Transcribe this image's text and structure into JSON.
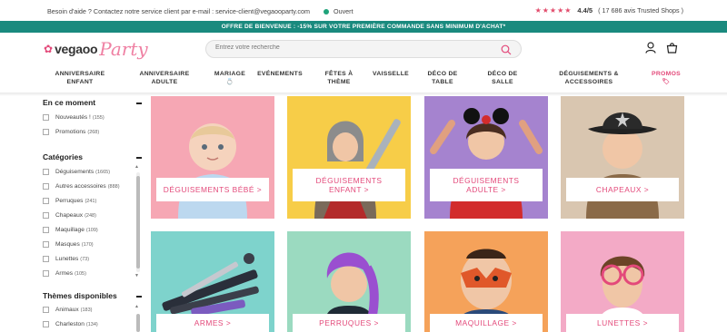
{
  "topbar": {
    "help_text": "Besoin d'aide ? Contactez notre service client par e-mail : service-client@vegaooparty.com",
    "status": "Ouvert",
    "stars": "★★★★★",
    "rating": "4.4/5",
    "reviews": "( 17 686 avis Trusted Shops )"
  },
  "promo_banner": "OFFRE DE BIENVENUE : -15% SUR VOTRE PREMIÈRE COMMANDE SANS MINIMUM D'ACHAT*",
  "logo": {
    "mark": "✿",
    "vega": "vegaoo",
    "party": "Party"
  },
  "search": {
    "placeholder": "Entrez votre recherche"
  },
  "nav": [
    {
      "line1": "Anniversaire",
      "line2": "Enfant"
    },
    {
      "line1": "Anniversaire",
      "line2": "Adulte"
    },
    {
      "line1": "Mariage",
      "line2": "💍"
    },
    {
      "line1": "Evénements",
      "line2": ""
    },
    {
      "line1": "Fêtes à",
      "line2": "Thème"
    },
    {
      "line1": "Vaisselle",
      "line2": ""
    },
    {
      "line1": "Déco de",
      "line2": "Table"
    },
    {
      "line1": "Déco de",
      "line2": "Salle"
    },
    {
      "line1": "Déguisements &",
      "line2": "Accessoires"
    },
    {
      "line1": "Promos",
      "line2": "🏷"
    }
  ],
  "sidebar": {
    "sections": [
      {
        "title": "En ce moment",
        "items": [
          {
            "label": "Nouveautés !",
            "count": "(155)"
          },
          {
            "label": "Promotions",
            "count": "(268)"
          }
        ]
      },
      {
        "title": "Catégories",
        "items": [
          {
            "label": "Déguisements",
            "count": "(1665)"
          },
          {
            "label": "Autres accessoires",
            "count": "(888)"
          },
          {
            "label": "Perruques",
            "count": "(241)"
          },
          {
            "label": "Chapeaux",
            "count": "(248)"
          },
          {
            "label": "Maquillage",
            "count": "(109)"
          },
          {
            "label": "Masques",
            "count": "(170)"
          },
          {
            "label": "Lunettes",
            "count": "(73)"
          },
          {
            "label": "Armes",
            "count": "(105)"
          }
        ]
      },
      {
        "title": "Thèmes disponibles",
        "items": [
          {
            "label": "Animaux",
            "count": "(183)"
          },
          {
            "label": "Charleston",
            "count": "(134)"
          }
        ]
      }
    ]
  },
  "tiles": [
    {
      "label1": "Déguisements Bébé >",
      "label2": "",
      "bg": "#f6a7b4"
    },
    {
      "label1": "Déguisements",
      "label2": "Enfant >",
      "bg": "#f7cd48"
    },
    {
      "label1": "Déguisements",
      "label2": "Adulte >",
      "bg": "#a583cf"
    },
    {
      "label1": "Chapeaux >",
      "label2": "",
      "bg": "#d9c6b0"
    },
    {
      "label1": "Armes >",
      "label2": "",
      "bg": "#7ed3cc"
    },
    {
      "label1": "Perruques >",
      "label2": "",
      "bg": "#9bdac0"
    },
    {
      "label1": "Maquillage >",
      "label2": "",
      "bg": "#f5a25a"
    },
    {
      "label1": "Lunettes >",
      "label2": "",
      "bg": "#f3aac6"
    }
  ],
  "colors": {
    "accent": "#e3497a",
    "banner": "#1a8a7e",
    "status": "#1fa37a"
  }
}
